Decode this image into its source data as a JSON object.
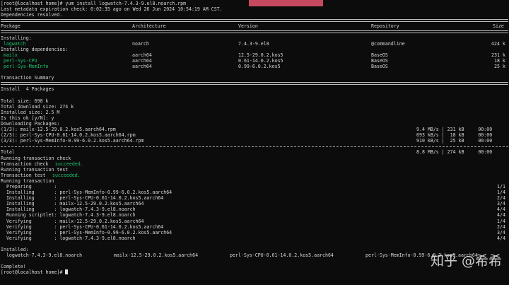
{
  "prompt": {
    "user": "root",
    "at": "@",
    "host": "localhost",
    "dir": "home",
    "command": "yum install logwatch-7.4.3-9.el8.noarch.rpm"
  },
  "lines": [
    {
      "type": "prompt"
    },
    {
      "type": "text",
      "text": "Last metadata expiration check: 0:02:35 ago on Wed 26 Jun 2024 10:54:19 AM CST."
    },
    {
      "type": "text",
      "text": "Dependencies resolved."
    },
    {
      "type": "rule"
    },
    {
      "type": "cols",
      "cells": [
        [
          0,
          "Package"
        ],
        [
          186,
          "Architecture"
        ],
        [
          336,
          "Version"
        ],
        [
          524,
          "Repository"
        ],
        [
          696,
          "Size"
        ]
      ]
    },
    {
      "type": "rule"
    },
    {
      "type": "text",
      "text": "Installing:"
    },
    {
      "type": "cols",
      "green": [
        0
      ],
      "cells": [
        [
          0,
          " logwatch"
        ],
        [
          186,
          "noarch"
        ],
        [
          336,
          "7.4.3-9.el8"
        ],
        [
          524,
          "@commandline"
        ],
        [
          694,
          "424 k"
        ]
      ]
    },
    {
      "type": "text",
      "text": "Installing dependencies:"
    },
    {
      "type": "cols",
      "green": [
        0
      ],
      "cells": [
        [
          0,
          " mailx"
        ],
        [
          186,
          "aarch64"
        ],
        [
          336,
          "12.5-29.0.2.kos5"
        ],
        [
          524,
          "BaseOS"
        ],
        [
          694,
          "231 k"
        ]
      ]
    },
    {
      "type": "cols",
      "green": [
        0
      ],
      "cells": [
        [
          0,
          " perl-Sys-CPU"
        ],
        [
          186,
          "aarch64"
        ],
        [
          336,
          "0.61-14.0.2.kos5"
        ],
        [
          524,
          "BaseOS"
        ],
        [
          698,
          "18 k"
        ]
      ]
    },
    {
      "type": "cols",
      "green": [
        0
      ],
      "cells": [
        [
          0,
          " perl-Sys-MemInfo"
        ],
        [
          186,
          "aarch64"
        ],
        [
          336,
          "0.99-6.0.2.kos5"
        ],
        [
          524,
          "BaseOS"
        ],
        [
          698,
          "25 k"
        ]
      ]
    },
    {
      "type": "blank"
    },
    {
      "type": "text",
      "text": "Transaction Summary"
    },
    {
      "type": "rule"
    },
    {
      "type": "text",
      "text": "Install  4 Packages"
    },
    {
      "type": "blank"
    },
    {
      "type": "text",
      "text": "Total size: 698 k"
    },
    {
      "type": "text",
      "text": "Total download size: 274 k"
    },
    {
      "type": "text",
      "text": "Installed size: 2.5 M"
    },
    {
      "type": "text",
      "text": "Is this ok [y/N]: y"
    },
    {
      "type": "text",
      "text": "Downloading Packages:"
    },
    {
      "type": "cols",
      "cells": [
        [
          0,
          "(1/3): mailx-12.5-29.0.2.kos5.aarch64.rpm"
        ],
        [
          588,
          "9.4 MB/s | 231 kB     00:00"
        ]
      ]
    },
    {
      "type": "cols",
      "cells": [
        [
          0,
          "(2/3): perl-Sys-CPU-0.61-14.0.2.kos5.aarch64.rpm"
        ],
        [
          588,
          "693 kB/s |  18 kB     00:00"
        ]
      ]
    },
    {
      "type": "cols",
      "cells": [
        [
          0,
          "(3/3): perl-Sys-MemInfo-0.99-6.0.2.kos5.aarch64.rpm"
        ],
        [
          588,
          "910 kB/s |  25 kB     00:00"
        ]
      ]
    },
    {
      "type": "hr"
    },
    {
      "type": "cols",
      "cells": [
        [
          0,
          "Total"
        ],
        [
          588,
          "8.8 MB/s | 274 kB     00:00"
        ]
      ]
    },
    {
      "type": "text",
      "text": "Running transaction check"
    },
    {
      "type": "cols",
      "green": [
        1
      ],
      "cells": [
        [
          0,
          "Transaction check "
        ],
        [
          77,
          "succeeded."
        ]
      ]
    },
    {
      "type": "text",
      "text": "Running transaction test"
    },
    {
      "type": "cols",
      "green": [
        1
      ],
      "cells": [
        [
          0,
          "Transaction test "
        ],
        [
          73,
          "succeeded."
        ]
      ]
    },
    {
      "type": "text",
      "text": "Running transaction"
    },
    {
      "type": "cols",
      "cells": [
        [
          0,
          "  Preparing        :"
        ],
        [
          702,
          "1/1"
        ]
      ]
    },
    {
      "type": "cols",
      "cells": [
        [
          0,
          "  Installing       : perl-Sys-MemInfo-0.99-6.0.2.kos5.aarch64"
        ],
        [
          702,
          "1/4"
        ]
      ]
    },
    {
      "type": "cols",
      "cells": [
        [
          0,
          "  Installing       : perl-Sys-CPU-0.61-14.0.2.kos5.aarch64"
        ],
        [
          702,
          "2/4"
        ]
      ]
    },
    {
      "type": "cols",
      "cells": [
        [
          0,
          "  Installing       : mailx-12.5-29.0.2.kos5.aarch64"
        ],
        [
          702,
          "3/4"
        ]
      ]
    },
    {
      "type": "cols",
      "cells": [
        [
          0,
          "  Installing       : logwatch-7.4.3-9.el8.noarch"
        ],
        [
          702,
          "4/4"
        ]
      ]
    },
    {
      "type": "cols",
      "cells": [
        [
          0,
          "  Running scriptlet: logwatch-7.4.3-9.el8.noarch"
        ],
        [
          702,
          "4/4"
        ]
      ]
    },
    {
      "type": "cols",
      "cells": [
        [
          0,
          "  Verifying        : mailx-12.5-29.0.2.kos5.aarch64"
        ],
        [
          702,
          "1/4"
        ]
      ]
    },
    {
      "type": "cols",
      "cells": [
        [
          0,
          "  Verifying        : perl-Sys-CPU-0.61-14.0.2.kos5.aarch64"
        ],
        [
          702,
          "2/4"
        ]
      ]
    },
    {
      "type": "cols",
      "cells": [
        [
          0,
          "  Verifying        : perl-Sys-MemInfo-0.99-6.0.2.kos5.aarch64"
        ],
        [
          702,
          "3/4"
        ]
      ]
    },
    {
      "type": "cols",
      "cells": [
        [
          0,
          "  Verifying        : logwatch-7.4.3-9.el8.noarch"
        ],
        [
          702,
          "4/4"
        ]
      ]
    },
    {
      "type": "blank"
    },
    {
      "type": "text",
      "text": "Installed:"
    },
    {
      "type": "cols",
      "cells": [
        [
          0,
          "  logwatch-7.4.3-9.el8.noarch"
        ],
        [
          160,
          "mailx-12.5-29.0.2.kos5.aarch64"
        ],
        [
          324,
          "perl-Sys-CPU-0.61-14.0.2.kos5.aarch64"
        ],
        [
          516,
          "perl-Sys-MemInfo-0.99-6.0.2.kos5.aarch64"
        ]
      ]
    },
    {
      "type": "blank"
    },
    {
      "type": "text",
      "text": "Complete!"
    },
    {
      "type": "prompt_end"
    }
  ],
  "watermark": "知乎 @希希",
  "colors": {
    "background": "#0c0c0c",
    "text": "#d6d6d6",
    "accent_green": "#1fc46f",
    "banner": "#e8556f"
  }
}
